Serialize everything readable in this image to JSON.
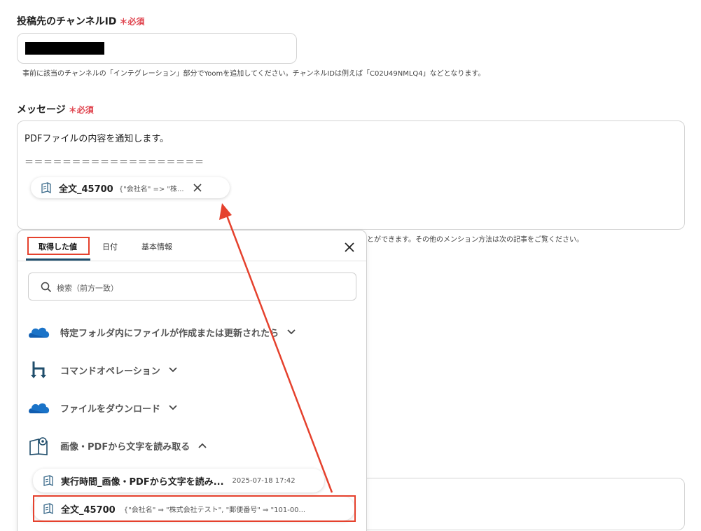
{
  "channel_field": {
    "label": "投稿先のチャンネルID",
    "required": "＊必須",
    "hint": "事前に該当のチャンネルの「インテグレーション」部分でYoomを追加してください。チャンネルIDは例えば「C02U49NMLQ4」などとなります。"
  },
  "message_field": {
    "label": "メッセージ",
    "required": "＊必須",
    "line1": "PDFファイルの内容を通知します。",
    "line2": "＝＝＝＝＝＝＝＝＝＝＝＝＝＝＝＝＝＝＝",
    "chip": {
      "name": "全文_45700",
      "value": "{\"会社名\" => \"株..."
    },
    "hint_tail": "とができます。その他のメンション方法は次の記事をご覧ください。"
  },
  "panel": {
    "tabs": [
      "取得した値",
      "日付",
      "基本情報"
    ],
    "active_tab": 0,
    "search_placeholder": "検索（前方一致）",
    "sections": [
      {
        "label": "特定フォルダ内にファイルが作成または更新されたら",
        "icon": "onedrive-icon",
        "expanded": false
      },
      {
        "label": "コマンドオペレーション",
        "icon": "command-branch-icon",
        "expanded": false
      },
      {
        "label": "ファイルをダウンロード",
        "icon": "onedrive-icon",
        "expanded": false
      },
      {
        "label": "画像・PDFから文字を読み取る",
        "icon": "ocr-book-icon",
        "expanded": true
      }
    ],
    "items": [
      {
        "name": "実行時間_画像・PDFから文字を読み...",
        "value": "2025-07-18 17:42"
      },
      {
        "name": "全文_45700",
        "value": "{\"会社名\" ⇒ \"株式会社テスト\", \"郵便番号\" ⇒ \"101-00..."
      }
    ]
  },
  "colors": {
    "required": "#e0454f",
    "highlight": "#e5412d",
    "tab_underline": "#1f4d6b",
    "onedrive": "#1a73c8",
    "command": "#1f4d6b"
  }
}
